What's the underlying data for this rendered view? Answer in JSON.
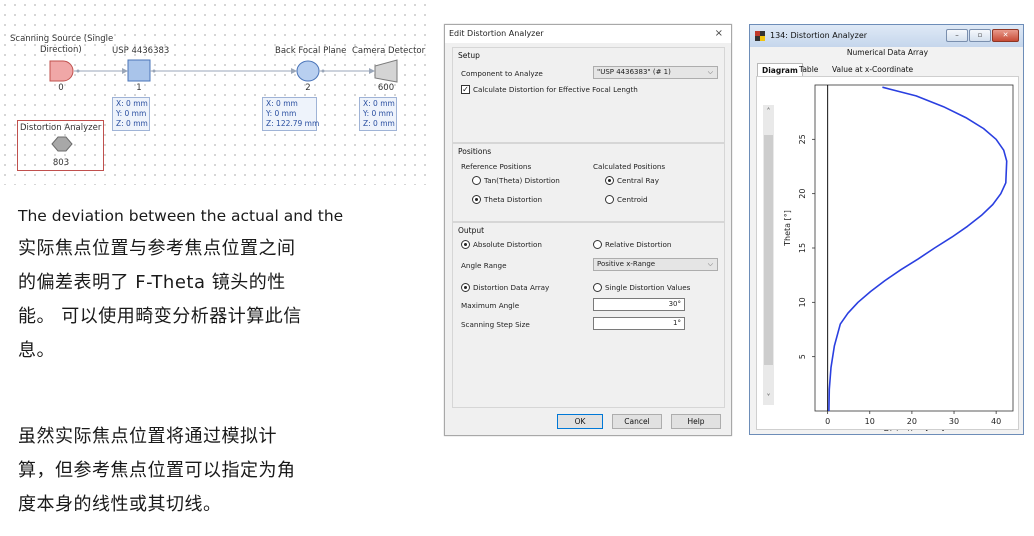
{
  "diagram": {
    "components": [
      {
        "id": "scan",
        "label_line1": "Scanning Source (Single",
        "label_line2": "Direction)",
        "number": "0"
      },
      {
        "id": "lens",
        "label": "USP 4436383",
        "number": "1"
      },
      {
        "id": "bfp",
        "label": "Back Focal Plane",
        "number": "2"
      },
      {
        "id": "cam",
        "label": "Camera Detector",
        "number": "600"
      }
    ],
    "positions": [
      {
        "x": "X: 0 mm",
        "y": "Y: 0 mm",
        "z": "Z: 0 mm"
      },
      {
        "x": "X: 0 mm",
        "y": "Y: 0 mm",
        "z": "Z: 122.79 mm"
      },
      {
        "x": "X: 0 mm",
        "y": "Y: 0 mm",
        "z": "Z: 0 mm"
      }
    ],
    "analyzer": {
      "label": "Distortion Analyzer",
      "number": "803"
    },
    "colors": {
      "source": "#f0a7a7",
      "lens": "#a9c4ea",
      "bfp": "#b8cff0",
      "camera": "#d4d4d4",
      "analyzer": "#a8a8a8",
      "selected_border": "#c0504d"
    }
  },
  "text": {
    "english": "The deviation between the actual and the",
    "zh_1": [
      " 实际焦点位置与参考焦点位置之间",
      "的偏差表明了 F-Theta 镜头的性",
      "能。 可以使用畸变分析器计算此信",
      "息。"
    ],
    "zh_2": [
      "虽然实际焦点位置将通过模拟计",
      "算，但参考焦点位置可以指定为角",
      "度本身的线性或其切线。"
    ]
  },
  "dialog": {
    "title": "Edit Distortion Analyzer",
    "close": "×",
    "setup": {
      "title": "Setup",
      "component_label": "Component to Analyze",
      "component_value": "\"USP 4436383\" (# 1)",
      "calc_checkbox": "Calculate Distortion for Effective Focal Length",
      "calc_checked": true
    },
    "positions": {
      "title": "Positions",
      "ref_header": "Reference Positions",
      "calc_header": "Calculated Positions",
      "ref_options": [
        "Tan(Theta) Distortion",
        "Theta Distortion"
      ],
      "ref_selected": 1,
      "calc_options": [
        "Central Ray",
        "Centroid"
      ],
      "calc_selected": 0
    },
    "output": {
      "title": "Output",
      "abs": "Absolute Distortion",
      "rel": "Relative Distortion",
      "abs_selected": true,
      "angle_range_label": "Angle Range",
      "angle_range_value": "Positive x-Range",
      "data_array": "Distortion Data Array",
      "single_values": "Single Distortion Values",
      "data_array_selected": true,
      "max_angle_label": "Maximum Angle",
      "max_angle_value": "30°",
      "step_label": "Scanning Step Size",
      "step_value": "1°"
    },
    "buttons": {
      "ok": "OK",
      "cancel": "Cancel",
      "help": "Help"
    }
  },
  "analyzer_window": {
    "title": "134: Distortion Analyzer",
    "subtitle": "Numerical Data Array",
    "tabs": [
      "Diagram",
      "Table",
      "Value at x-Coordinate"
    ],
    "active_tab": 0
  },
  "chart_data": {
    "type": "line",
    "title": "",
    "xlabel": "Distortion [µm]",
    "ylabel": "Theta [°]",
    "xlim": [
      -3,
      44
    ],
    "ylim": [
      0,
      30
    ],
    "xticks": [
      0,
      10,
      20,
      30,
      40
    ],
    "yticks": [
      5,
      10,
      15,
      20,
      25
    ],
    "series": [
      {
        "color": "#2a3fe0",
        "x": [
          0.3,
          0.4,
          0.8,
          1.6,
          3.0,
          4.8,
          7.2,
          10.2,
          13.6,
          17.4,
          21.5,
          25.4,
          29.5,
          33.2,
          36.5,
          39.2,
          41.1,
          42.3,
          42.5,
          41.8,
          40.0,
          37.0,
          32.8,
          27.5,
          21.0,
          13.0
        ],
        "y": [
          0,
          2,
          4,
          6,
          8,
          9,
          10,
          11,
          12,
          13,
          14,
          15,
          16,
          17,
          18,
          19,
          20,
          21,
          23,
          24,
          25,
          26,
          27,
          28,
          29,
          29.8
        ]
      }
    ]
  }
}
